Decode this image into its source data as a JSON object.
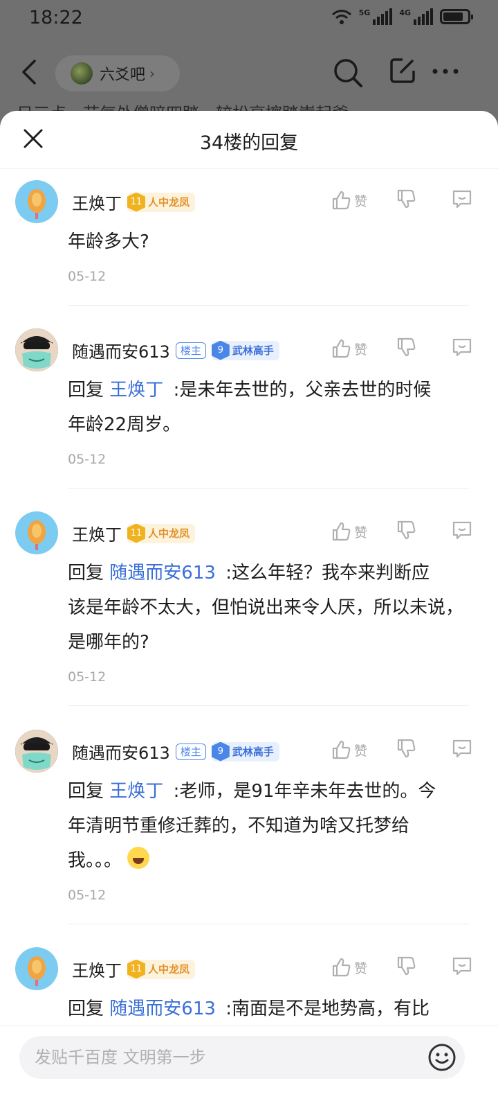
{
  "status": {
    "time": "18:22",
    "net1": "5G",
    "net2": "4G"
  },
  "nav": {
    "forum_name": "六爻吧",
    "forum_arrow": "›",
    "peek_text": "日三点，节气处僧暗四踏，较松亮擦踏嵩起爹~"
  },
  "sheet": {
    "title": "34楼的回复"
  },
  "replies": [
    {
      "user": "王焕丁",
      "level": "11",
      "title": "人中龙凤",
      "badge_type": "gold",
      "is_op": false,
      "reply_prefix": "",
      "reply_to": "",
      "text": "年龄多大?",
      "text2": "",
      "date": "05-12",
      "like": "赞"
    },
    {
      "user": "随遇而安613",
      "op_label": "楼主",
      "level": "9",
      "title": "武林高手",
      "badge_type": "blue",
      "is_op": true,
      "reply_prefix": "回复",
      "reply_to": "王焕丁",
      "text": ":是未年去世的，父亲去世的时候",
      "text2": "年龄22周岁。",
      "date": "05-12",
      "like": "赞"
    },
    {
      "user": "王焕丁",
      "level": "11",
      "title": "人中龙凤",
      "badge_type": "gold",
      "is_op": false,
      "reply_prefix": "回复",
      "reply_to": "随遇而安613",
      "text": ":这么年轻？我夲来判断应",
      "text2": "该是年龄不太大，但怕说出来令人厌，所以未说，",
      "text3": "是哪年的?",
      "date": "05-12",
      "like": "赞"
    },
    {
      "user": "随遇而安613",
      "op_label": "楼主",
      "level": "9",
      "title": "武林高手",
      "badge_type": "blue",
      "is_op": true,
      "reply_prefix": "回复",
      "reply_to": "王焕丁",
      "text": ":老师，是91年辛未年去世的。今",
      "text2": "年清明节重修迁葬的，不知道为啥又托梦给",
      "text3": "我。。。",
      "emoji": "crying-face",
      "date": "05-12",
      "like": "赞"
    },
    {
      "user": "王焕丁",
      "level": "11",
      "title": "人中龙凤",
      "badge_type": "gold",
      "is_op": false,
      "reply_prefix": "回复",
      "reply_to": "随遇而安613",
      "text": ":南面是不是地势高，有比",
      "text2": "",
      "date": "",
      "like": "赞"
    }
  ],
  "bottom": {
    "placeholder": "发贴千百度 文明第一步"
  },
  "colors": {
    "link": "#3a6fd8",
    "gold_badge": "#f0b21f",
    "blue_badge": "#4a86e8",
    "muted": "#a8a8a8"
  }
}
